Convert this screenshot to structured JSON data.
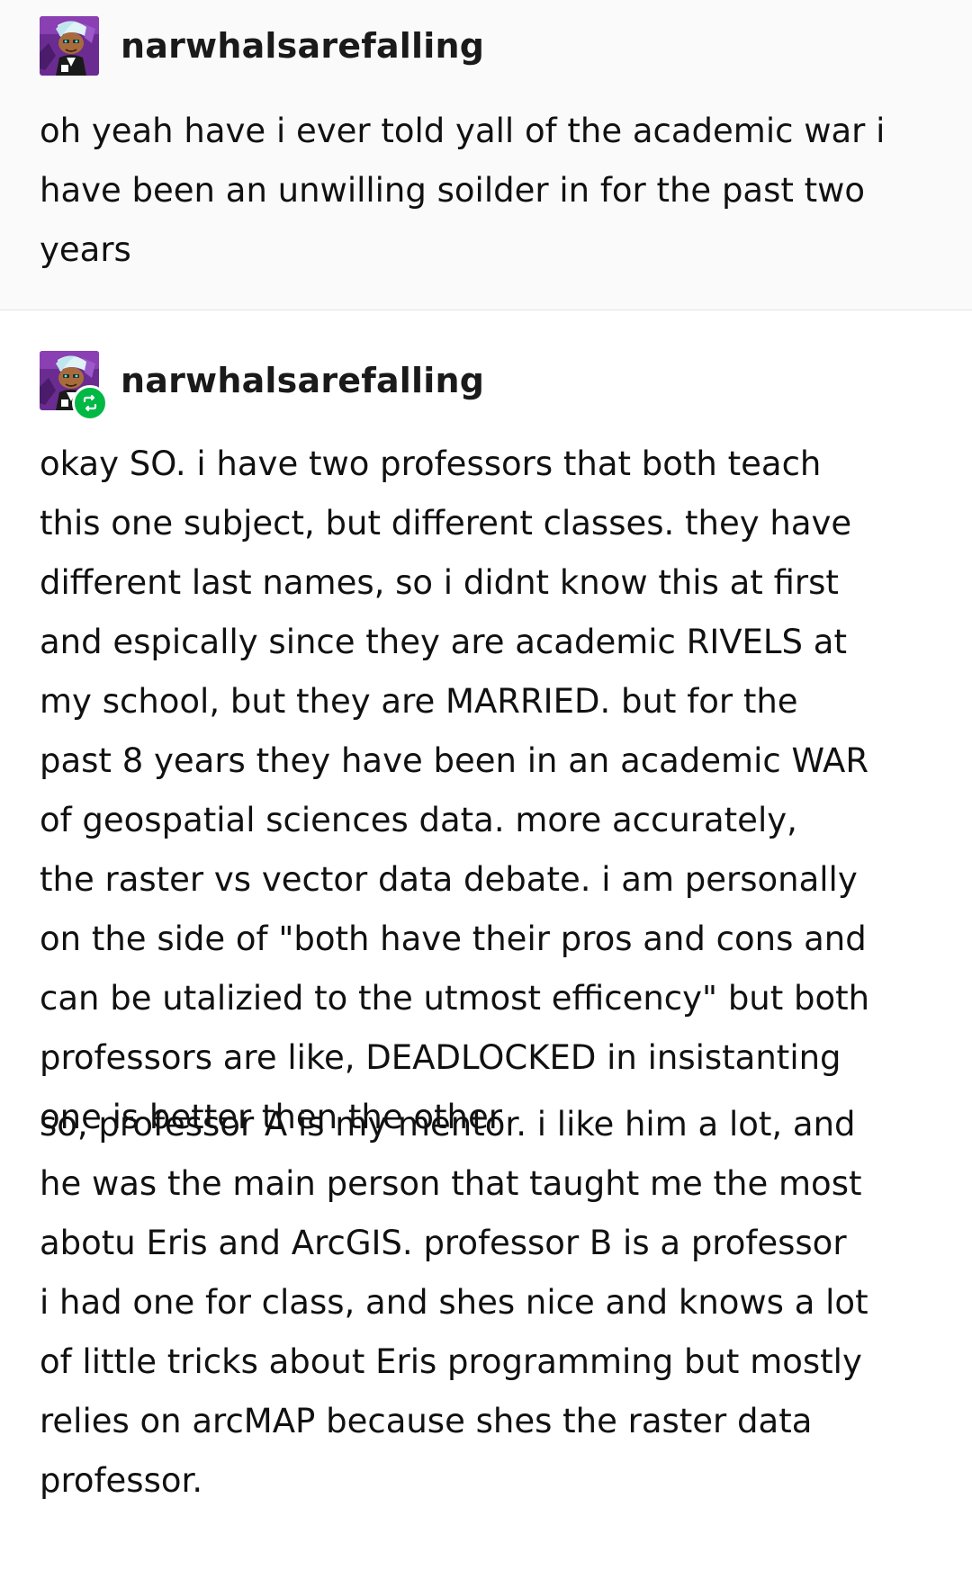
{
  "posts": [
    {
      "username": "narwhalsarefalling",
      "paragraphs": [
        "oh yeah have i ever told yall of the academic war i\nhave been an unwilling soilder in for the past two\nyears"
      ]
    },
    {
      "username": "narwhalsarefalling",
      "reblogged": true,
      "paragraphs": [
        "okay SO. i have two professors that both teach\nthis one subject, but different classes. they have\ndifferent last names, so i didnt know this at first\nand espically since they are academic RIVELS at\nmy school, but they are MARRIED. but for the\npast 8 years they have been in an academic WAR\nof geospatial sciences data. more accurately,\nthe raster vs vector data debate. i am personally\non the side of \"both have their pros and cons and\ncan be utalizied to the utmost efficency\" but both\nprofessors are like, DEADLOCKED in insistanting\none is better then the other",
        "so, professor A is my mentor. i like him a lot, and\nhe was the main person that taught me the most\nabotu Eris and ArcGIS. professor B is a professor\ni had one for class, and shes nice and knows a lot\nof little tricks about Eris programming but mostly\nrelies on arcMAP because shes the raster data\nprofessor."
      ]
    }
  ],
  "icons": {
    "avatar": "avatar-icon",
    "reblog": "reblog-icon"
  },
  "colors": {
    "reblog_badge": "#00b844",
    "first_post_bg": "#fafafa",
    "divider": "#e3e3e3",
    "text": "#111111"
  }
}
